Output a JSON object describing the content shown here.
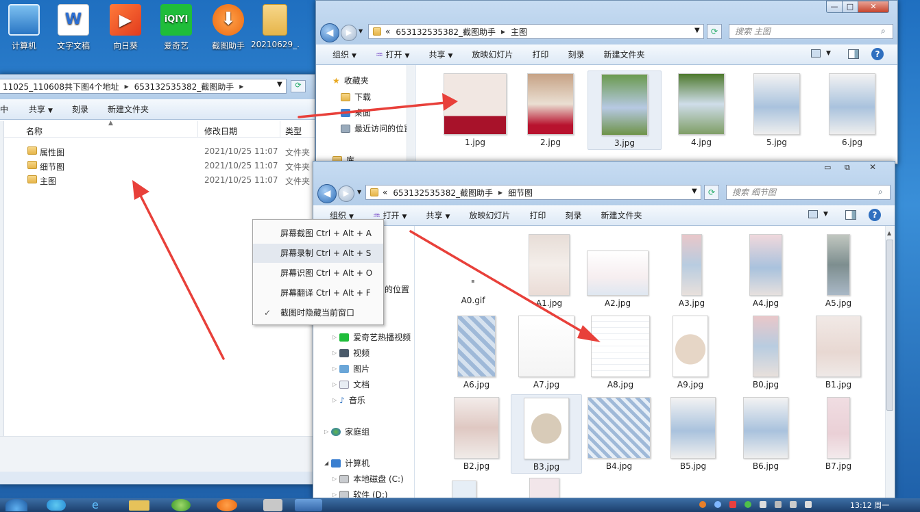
{
  "desktop": {
    "icons": [
      {
        "label": "计算机"
      },
      {
        "label": "文字文稿"
      },
      {
        "label": "向日葵"
      },
      {
        "label": "爱奇艺"
      },
      {
        "label": "截图助手"
      },
      {
        "label": "20210629_..."
      }
    ]
  },
  "win_left": {
    "address": {
      "part1": "11025_110608共下图4个地址",
      "part2": "653132535382_截图助手"
    },
    "toolbar": [
      "中",
      "共享",
      "刻录",
      "新建文件夹"
    ],
    "columns": {
      "name": "名称",
      "date": "修改日期",
      "type": "类型"
    },
    "rows": [
      {
        "name": "属性图",
        "date": "2021/10/25 11:07",
        "type": "文件夹"
      },
      {
        "name": "细节图",
        "date": "2021/10/25 11:07",
        "type": "文件夹"
      },
      {
        "name": "主图",
        "date": "2021/10/25 11:07",
        "type": "文件夹"
      }
    ]
  },
  "win_main": {
    "address": {
      "prefix": "«",
      "part1": "653132535382_截图助手",
      "part2": "主图"
    },
    "search_placeholder": "搜索 主图",
    "toolbar": [
      "组织",
      "打开",
      "共享",
      "放映幻灯片",
      "打印",
      "刻录",
      "新建文件夹"
    ],
    "nav": [
      "收藏夹",
      "下载",
      "桌面",
      "最近访问的位置",
      "库"
    ],
    "files": [
      "1.jpg",
      "2.jpg",
      "3.jpg",
      "4.jpg",
      "5.jpg",
      "6.jpg"
    ]
  },
  "win_detail": {
    "address": {
      "prefix": "«",
      "part1": "653132535382_截图助手",
      "part2": "细节图"
    },
    "search_placeholder": "搜索 细节图",
    "toolbar": [
      "组织",
      "打开",
      "共享",
      "放映幻灯片",
      "打印",
      "刻录",
      "新建文件夹"
    ],
    "nav": [
      "的位置",
      "爱奇艺热播视频",
      "视频",
      "图片",
      "文档",
      "音乐",
      "家庭组",
      "计算机",
      "本地磁盘 (C:)",
      "软件 (D:)"
    ],
    "files": [
      "A0.gif",
      "A1.jpg",
      "A2.jpg",
      "A3.jpg",
      "A4.jpg",
      "A5.jpg",
      "A6.jpg",
      "A7.jpg",
      "A8.jpg",
      "A9.jpg",
      "B0.jpg",
      "B1.jpg",
      "B2.jpg",
      "B3.jpg",
      "B4.jpg",
      "B5.jpg",
      "B6.jpg",
      "B7.jpg"
    ]
  },
  "context_menu": {
    "items": [
      "屏幕截图 Ctrl + Alt + A",
      "屏幕录制 Ctrl + Alt + S",
      "屏幕识图 Ctrl + Alt + O",
      "屏幕翻译 Ctrl + Alt + F",
      "截图时隐藏当前窗口"
    ],
    "checkmark": "✓"
  },
  "taskbar": {
    "clock": "13:12 周一"
  },
  "colors": {
    "arrow": "#e8403a",
    "toolbar_bg": "#dde9f6",
    "window_frame": "#b3cde9"
  }
}
